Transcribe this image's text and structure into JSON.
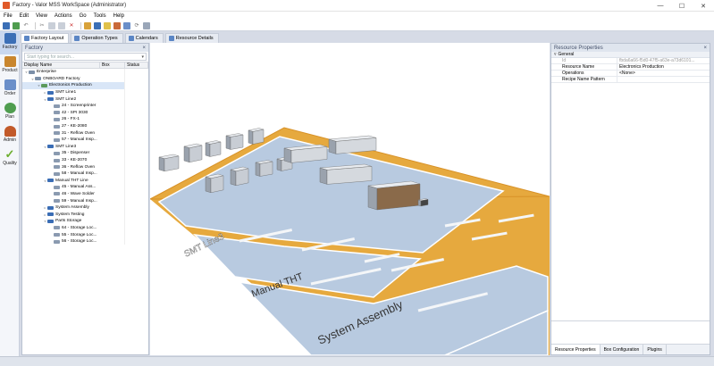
{
  "window": {
    "title": "Factory - Valor MSS WorkSpace (Administrator)",
    "min": "—",
    "max": "☐",
    "close": "✕"
  },
  "menu": [
    "File",
    "Edit",
    "View",
    "Actions",
    "Go",
    "Tools",
    "Help"
  ],
  "nav": [
    {
      "label": "Factory",
      "icon": "factory-icon",
      "color": "#3b6fb6"
    },
    {
      "label": "Product",
      "icon": "product-icon",
      "color": "#c9862e"
    },
    {
      "label": "Order",
      "icon": "order-icon",
      "color": "#6b8fc9"
    },
    {
      "label": "Plan",
      "icon": "plan-icon",
      "color": "#4f9d4f"
    },
    {
      "label": "Admin",
      "icon": "admin-icon",
      "color": "#c25a2a"
    },
    {
      "label": "Quality",
      "icon": "quality-icon",
      "color": "#6cae2e"
    }
  ],
  "tabs": [
    "Factory Layout",
    "Operation Types",
    "Calendars",
    "Resource Details"
  ],
  "factory_panel": {
    "title": "Factory",
    "search_placeholder": "Start typing for search...",
    "columns": [
      "Display Name",
      "Box",
      "Status"
    ],
    "tree": [
      {
        "label": "Enterprise",
        "level": 0,
        "exp": "▿",
        "color": "#7b8fa8"
      },
      {
        "label": "ONBOARD Factory",
        "level": 1,
        "exp": "▿",
        "color": "#7b8fa8"
      },
      {
        "label": "Electronics Production",
        "level": 2,
        "exp": "▿",
        "color": "#5c9a5c",
        "selected": true
      },
      {
        "label": "SMT Line1",
        "level": 3,
        "exp": "▹",
        "color": "#3a6db5"
      },
      {
        "label": "SMT Line2",
        "level": 3,
        "exp": "▿",
        "color": "#3a6db5"
      },
      {
        "label": "24 - Screenprinter",
        "level": 4,
        "exp": "",
        "color": "#8a9ab0"
      },
      {
        "label": "42 - SPI 3030",
        "level": 4,
        "exp": "",
        "color": "#8a9ab0"
      },
      {
        "label": "26 - FX-1",
        "level": 4,
        "exp": "",
        "color": "#8a9ab0"
      },
      {
        "label": "27 - KE-2080",
        "level": 4,
        "exp": "",
        "color": "#8a9ab0"
      },
      {
        "label": "31 - Reflow Oven",
        "level": 4,
        "exp": "",
        "color": "#8a9ab0"
      },
      {
        "label": "57 - Manual Insp...",
        "level": 4,
        "exp": "",
        "color": "#8a9ab0"
      },
      {
        "label": "SMT Line3",
        "level": 3,
        "exp": "▿",
        "color": "#3a6db5"
      },
      {
        "label": "35 - Dispenser",
        "level": 4,
        "exp": "",
        "color": "#8a9ab0"
      },
      {
        "label": "33 - KE-2070",
        "level": 4,
        "exp": "",
        "color": "#8a9ab0"
      },
      {
        "label": "36 - Reflow Oven",
        "level": 4,
        "exp": "",
        "color": "#8a9ab0"
      },
      {
        "label": "58 - Manual Insp...",
        "level": 4,
        "exp": "",
        "color": "#8a9ab0"
      },
      {
        "label": "Manual THT Line",
        "level": 3,
        "exp": "▿",
        "color": "#3a6db5"
      },
      {
        "label": "45 - Manual Ass...",
        "level": 4,
        "exp": "",
        "color": "#8a9ab0"
      },
      {
        "label": "46 - Wave Solder",
        "level": 4,
        "exp": "",
        "color": "#8a9ab0"
      },
      {
        "label": "59 - Manual Insp...",
        "level": 4,
        "exp": "",
        "color": "#8a9ab0"
      },
      {
        "label": "System Assembly",
        "level": 3,
        "exp": "▹",
        "color": "#3a6db5"
      },
      {
        "label": "System Testing",
        "level": 3,
        "exp": "▹",
        "color": "#3a6db5"
      },
      {
        "label": "Parts Storage",
        "level": 3,
        "exp": "▿",
        "color": "#3a6db5"
      },
      {
        "label": "64 - Storage Loc...",
        "level": 4,
        "exp": "",
        "color": "#8a9ab0"
      },
      {
        "label": "55 - Storage Loc...",
        "level": 4,
        "exp": "",
        "color": "#8a9ab0"
      },
      {
        "label": "56 - Storage Loc...",
        "level": 4,
        "exp": "",
        "color": "#8a9ab0"
      }
    ]
  },
  "layout_labels": [
    "SMT Line3",
    "Manual THT",
    "System Assembly"
  ],
  "resource_panel": {
    "title": "Resource Properties",
    "group": "General",
    "rows": [
      {
        "key": "Id",
        "value": "fbda6a66-f5d0-47f5-a63e-a73d6101...",
        "dim": true
      },
      {
        "key": "Resource Name",
        "value": "Electronics Production",
        "dim": false
      },
      {
        "key": "Operations",
        "value": "<None>",
        "dim": false
      },
      {
        "key": "Recipe Name Pattern",
        "value": "",
        "dim": false
      }
    ],
    "bottom_tabs": [
      "Resource Properties",
      "Box Configuration",
      "Plugins"
    ]
  },
  "colors": {
    "floor": "#e6a93e",
    "zone": "#b9cbe0",
    "accent": "#3b6fb6"
  }
}
